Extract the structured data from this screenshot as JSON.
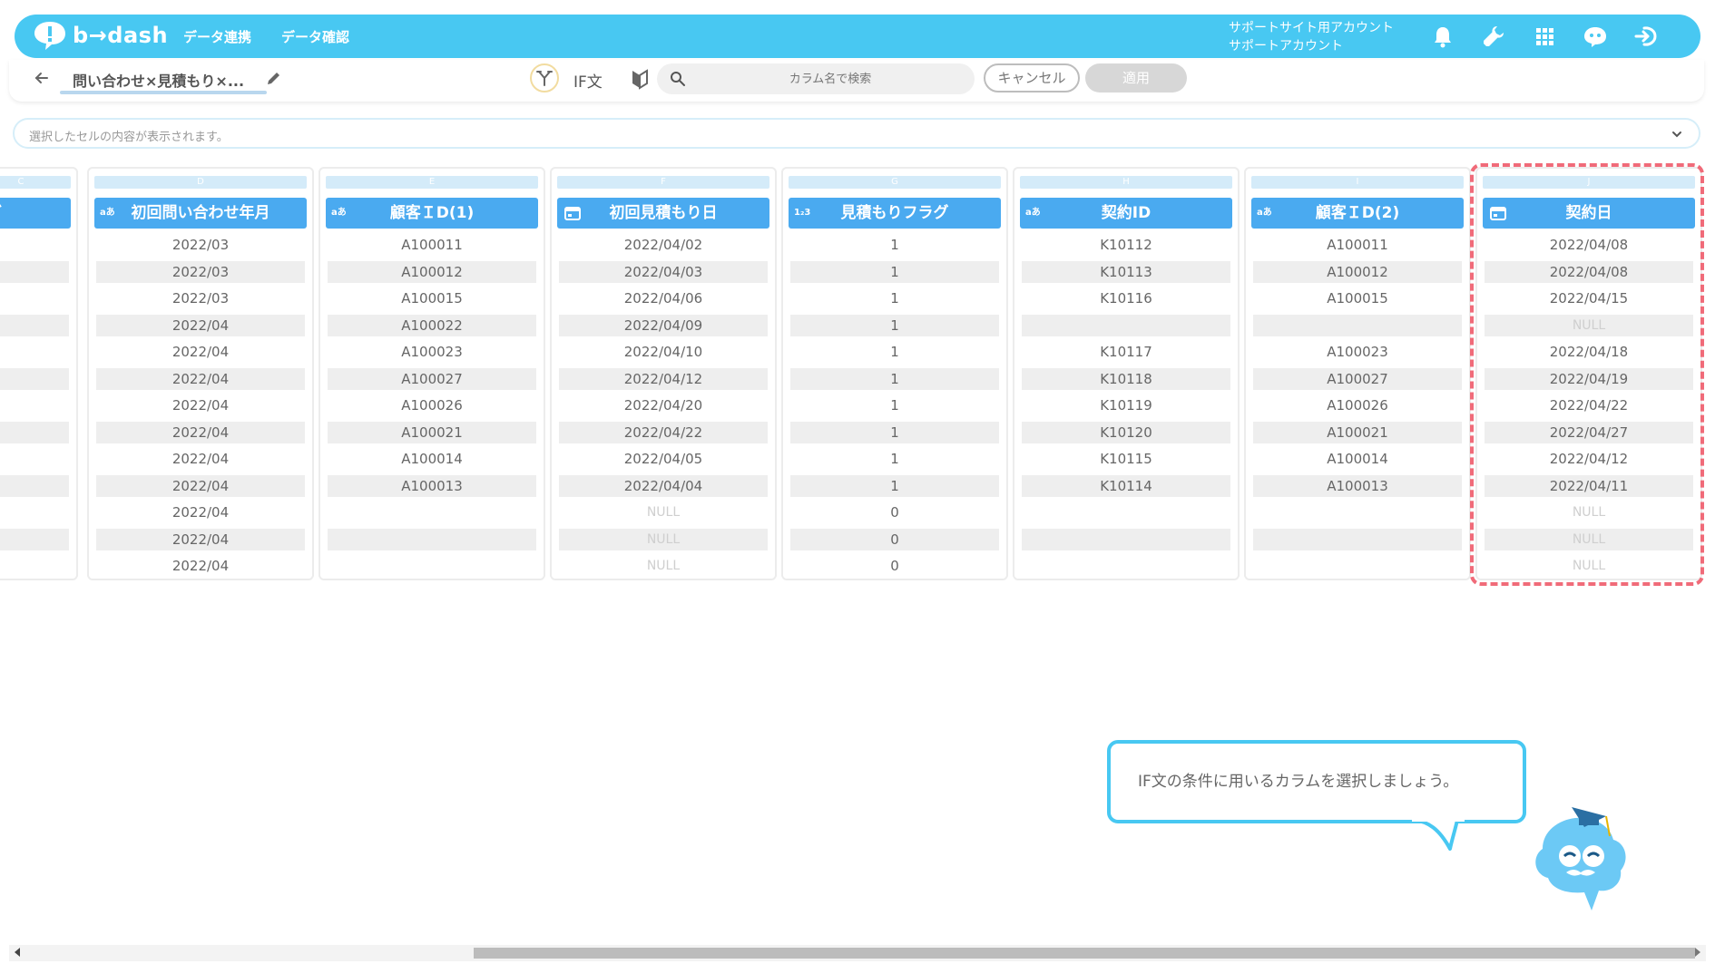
{
  "brand": {
    "name": "b→dash",
    "color": "#48c8f2"
  },
  "nav": [
    {
      "label": "データ連携"
    },
    {
      "label": "データ確認"
    }
  ],
  "account": {
    "line1": "サポートサイト用アカウント",
    "line2": "サポートアカウント"
  },
  "top_icons": [
    "bell-icon",
    "wrench-icon",
    "grid-menu-icon",
    "mascot-chat-icon",
    "logout-icon"
  ],
  "toolbar": {
    "project_title": "問い合わせ×見積もり×...",
    "if_label": "IF文",
    "search_placeholder": "カラム名で検索",
    "cancel_label": "キャンセル",
    "apply_label": "適用"
  },
  "cellbar": {
    "placeholder": "選択したセルの内容が表示されます。"
  },
  "columns": [
    {
      "letter": "C",
      "name": "ラグ",
      "type": "",
      "cells": [
        "",
        "",
        "",
        "",
        "",
        "",
        "",
        "",
        "",
        "",
        "",
        "",
        ""
      ]
    },
    {
      "letter": "D",
      "name": "初回問い合わせ年月",
      "type": "aあ",
      "cells": [
        "2022/03",
        "2022/03",
        "2022/03",
        "2022/04",
        "2022/04",
        "2022/04",
        "2022/04",
        "2022/04",
        "2022/04",
        "2022/04",
        "2022/04",
        "2022/04",
        "2022/04"
      ]
    },
    {
      "letter": "E",
      "name": "顧客ＩD(1)",
      "type": "aあ",
      "cells": [
        "A100011",
        "A100012",
        "A100015",
        "A100022",
        "A100023",
        "A100027",
        "A100026",
        "A100021",
        "A100014",
        "A100013",
        "",
        "",
        ""
      ]
    },
    {
      "letter": "F",
      "name": "初回見積もり日",
      "type": "calendar",
      "cells": [
        "2022/04/02",
        "2022/04/03",
        "2022/04/06",
        "2022/04/09",
        "2022/04/10",
        "2022/04/12",
        "2022/04/20",
        "2022/04/22",
        "2022/04/05",
        "2022/04/04",
        "NULL",
        "NULL",
        "NULL"
      ]
    },
    {
      "letter": "G",
      "name": "見積もりフラグ",
      "type": "1₂3",
      "cells": [
        "1",
        "1",
        "1",
        "1",
        "1",
        "1",
        "1",
        "1",
        "1",
        "1",
        "0",
        "0",
        "0"
      ]
    },
    {
      "letter": "H",
      "name": "契約ID",
      "type": "aあ",
      "cells": [
        "K10112",
        "K10113",
        "K10116",
        "",
        "K10117",
        "K10118",
        "K10119",
        "K10120",
        "K10115",
        "K10114",
        "",
        "",
        ""
      ]
    },
    {
      "letter": "I",
      "name": "顧客ＩD(2)",
      "type": "aあ",
      "cells": [
        "A100011",
        "A100012",
        "A100015",
        "",
        "A100023",
        "A100027",
        "A100026",
        "A100021",
        "A100014",
        "A100013",
        "",
        "",
        ""
      ]
    },
    {
      "letter": "J",
      "name": "契約日",
      "type": "calendar",
      "cells": [
        "2022/04/08",
        "2022/04/08",
        "2022/04/15",
        "NULL",
        "2022/04/18",
        "2022/04/19",
        "2022/04/22",
        "2022/04/27",
        "2022/04/12",
        "2022/04/11",
        "NULL",
        "NULL",
        "NULL"
      ]
    }
  ],
  "tooltip": {
    "text": "IF文の条件に用いるカラムを選択しましょう。"
  },
  "colors": {
    "header_blue": "#4aaaf0",
    "highlight": "#f06b79",
    "null_text": "#cfcfcf"
  }
}
